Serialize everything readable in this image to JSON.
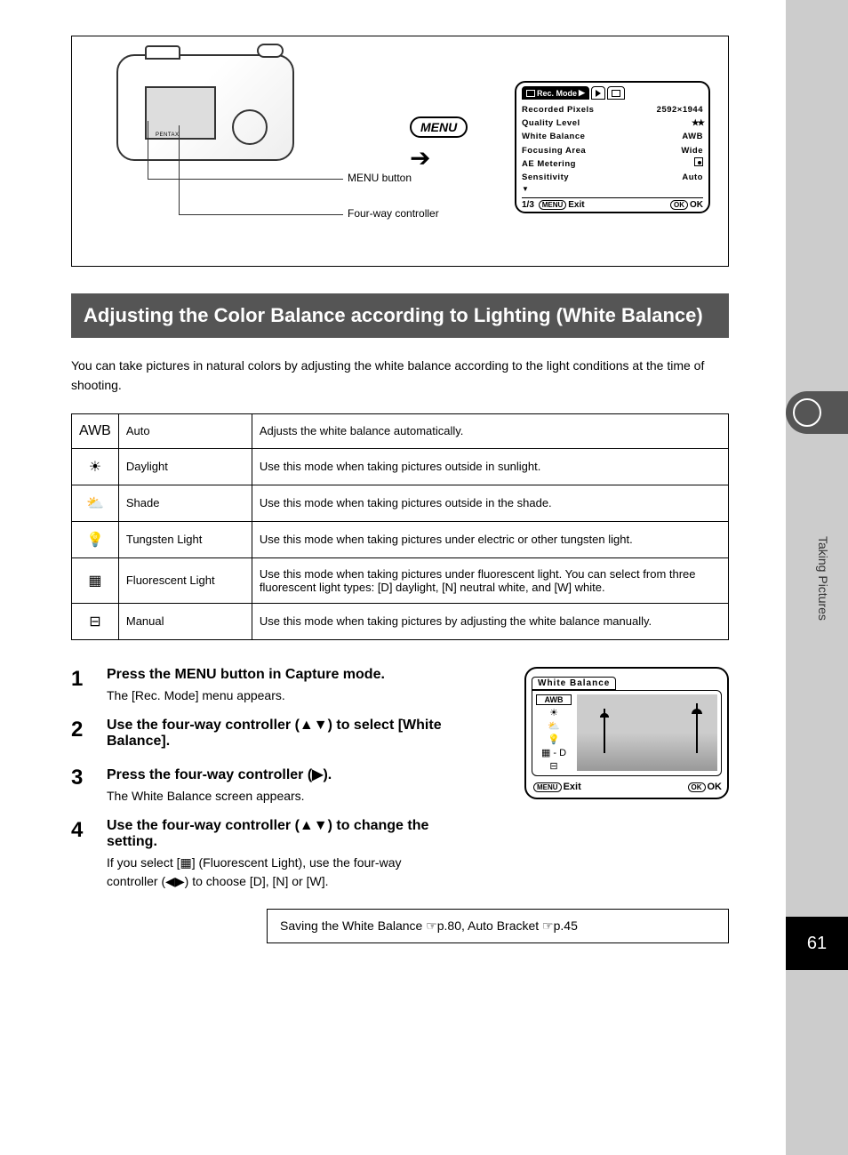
{
  "page_number": "61",
  "side_text": "Taking Pictures",
  "diagram": {
    "lead_label_1": "MENU button",
    "lead_label_2": "Four-way controller",
    "menu_pill": "MENU",
    "camera_brand": "PENTAX"
  },
  "lcd_menu": {
    "tab_active": "Rec. Mode",
    "rows": [
      {
        "label": "Recorded Pixels",
        "value": "2592×1944"
      },
      {
        "label": "Quality Level",
        "value": "★★"
      },
      {
        "label": "White Balance",
        "value": "AWB"
      },
      {
        "label": "Focusing Area",
        "value": "Wide"
      },
      {
        "label": "AE Metering",
        "value": ""
      },
      {
        "label": "Sensitivity",
        "value": "Auto"
      }
    ],
    "footer_left_page": "1/3",
    "footer_left_label": "Exit",
    "footer_right_label": "OK",
    "menu_abbr": "MENU",
    "ok_abbr": "OK"
  },
  "section_title": "Adjusting the Color Balance according to Lighting (White Balance)",
  "intro": "You can take pictures in natural colors by adjusting the white balance according to the light conditions at the time of shooting.",
  "table": {
    "rows": [
      {
        "icon": "AWB",
        "mode": "Auto",
        "desc": "Adjusts the white balance automatically."
      },
      {
        "icon": "☀",
        "mode": "Daylight",
        "desc": "Use this mode when taking pictures outside in sunlight."
      },
      {
        "icon": "⛅",
        "mode": "Shade",
        "desc": "Use this mode when taking pictures outside in the shade."
      },
      {
        "icon": "💡",
        "mode": "Tungsten Light",
        "desc": "Use this mode when taking pictures under electric or other tungsten light."
      },
      {
        "icon": "▦",
        "mode": "Fluorescent Light",
        "desc": "Use this mode when taking pictures under fluorescent light. You can select from three fluorescent light types: [D] daylight, [N] neutral white, and [W] white."
      },
      {
        "icon": "⊟",
        "mode": "Manual",
        "desc": "Use this mode when taking pictures by adjusting the white balance manually."
      }
    ]
  },
  "steps": [
    {
      "num": "1",
      "title": "Press the MENU button in Capture mode.",
      "text": "The [Rec. Mode] menu appears."
    },
    {
      "num": "2",
      "title": "Use the four-way controller (▲▼) to select [White Balance].",
      "text": ""
    },
    {
      "num": "3",
      "title": "Press the four-way controller (▶).",
      "text": "The White Balance screen appears."
    },
    {
      "num": "4",
      "title": "Use the four-way controller (▲▼) to change the setting.",
      "text": "If you select [▦] (Fluorescent Light), use the four-way controller (◀▶) to choose [D], [N] or [W]."
    }
  ],
  "wb_popup": {
    "title": "White Balance",
    "selected": "AWB",
    "fluoro_suffix": "- D",
    "footer_exit": "Exit",
    "footer_ok": "OK",
    "menu_abbr": "MENU",
    "ok_abbr": "OK"
  },
  "ref_box": "Saving the White Balance ☞p.80, Auto Bracket ☞p.45"
}
